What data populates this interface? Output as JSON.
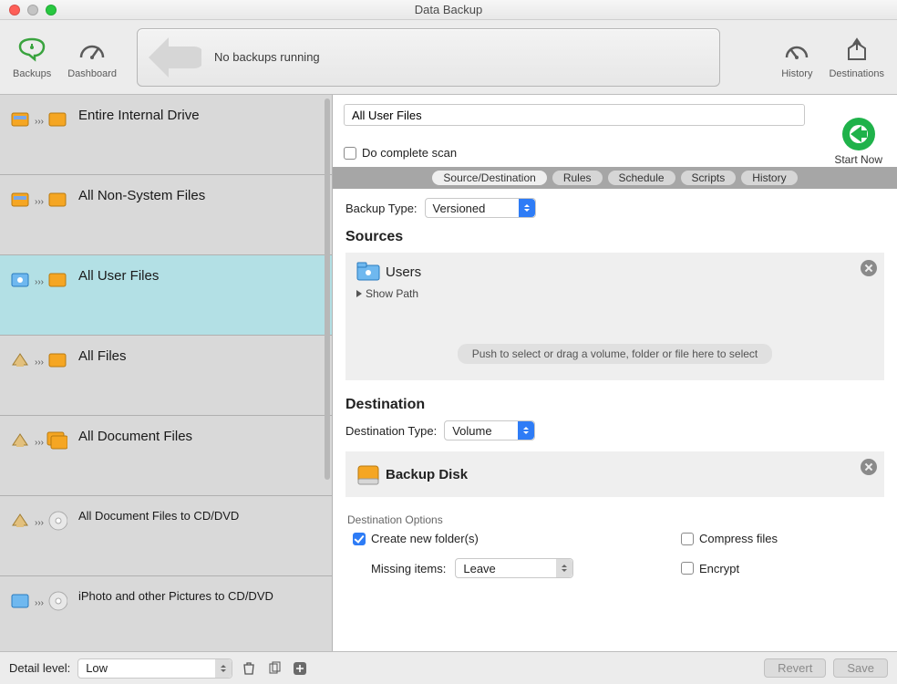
{
  "window": {
    "title": "Data Backup"
  },
  "toolbar": {
    "backups_label": "Backups",
    "dashboard_label": "Dashboard",
    "history_label": "History",
    "destinations_label": "Destinations",
    "status_text": "No backups running"
  },
  "sidebar": {
    "items": [
      {
        "label": "Entire Internal Drive"
      },
      {
        "label": "All Non-System Files"
      },
      {
        "label": "All User Files"
      },
      {
        "label": "All Files"
      },
      {
        "label": "All Document Files"
      },
      {
        "label": "All Document Files to CD/DVD"
      },
      {
        "label": "iPhoto and other Pictures to CD/DVD"
      }
    ],
    "selected_index": 2
  },
  "main": {
    "name_value": "All User Files",
    "scan_label": "Do complete scan",
    "startnow_label": "Start Now",
    "tabs": [
      "Source/Destination",
      "Rules",
      "Schedule",
      "Scripts",
      "History"
    ],
    "active_tab": 0,
    "backup_type_label": "Backup Type:",
    "backup_type_value": "Versioned",
    "sources_heading": "Sources",
    "source_name": "Users",
    "show_path_label": "Show Path",
    "drop_hint": "Push to select or drag a volume, folder or file here to select",
    "destination_heading": "Destination",
    "destination_type_label": "Destination Type:",
    "destination_type_value": "Volume",
    "destination_name": "Backup Disk",
    "dest_options_heading": "Destination Options",
    "create_folders_label": "Create new folder(s)",
    "create_folders_checked": true,
    "compress_label": "Compress files",
    "missing_items_label": "Missing items:",
    "missing_items_value": "Leave",
    "encrypt_label": "Encrypt"
  },
  "footer": {
    "detail_label": "Detail level:",
    "detail_value": "Low",
    "revert_label": "Revert",
    "save_label": "Save"
  },
  "colors": {
    "accent_green": "#1fb24a",
    "accent_blue": "#2e7cf6",
    "selected_row": "#b3e0e5"
  }
}
